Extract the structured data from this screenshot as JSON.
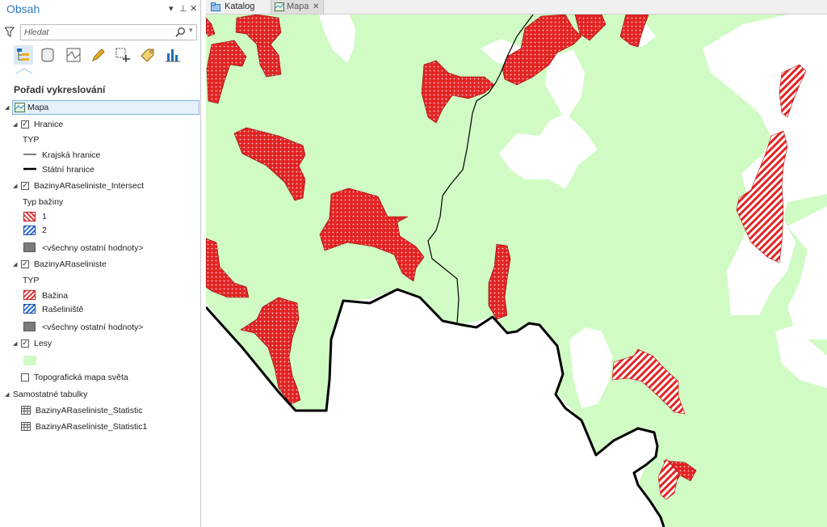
{
  "panel": {
    "title": "Obsah",
    "controls": {
      "menu": "▾",
      "pin": "⊥",
      "close": "✕"
    },
    "search": {
      "placeholder": "Hledat"
    },
    "section_title": "Pořadí vykreslování",
    "layers": {
      "map": "Mapa",
      "hranice": {
        "name": "Hranice",
        "checked": true,
        "heading": "TYP",
        "items": [
          "Krajská hranice",
          "Státní hranice"
        ]
      },
      "intersect": {
        "name": "BazinyARaseliniste_Intersect",
        "checked": true,
        "heading": "Typ bažiny",
        "items": [
          "1",
          "2",
          "<všechny ostatní hodnoty>"
        ]
      },
      "raseliniste": {
        "name": "BazinyARaseliniste",
        "checked": true,
        "heading": "TYP",
        "items": [
          "Bažina",
          "Rašeliniště",
          "<všechny ostatní hodnoty>"
        ]
      },
      "lesy": {
        "name": "Lesy",
        "checked": true
      },
      "basemap": {
        "name": "Topografická mapa světa",
        "checked": false
      }
    },
    "tables": {
      "heading": "Samostatné tabulky",
      "items": [
        "BazinyARaseliniste_Statistic",
        "BazinyARaseliniste_Statistic1"
      ]
    }
  },
  "tabs": [
    {
      "label": "Katalog",
      "icon": "catalog-icon"
    },
    {
      "label": "Mapa",
      "icon": "map-icon",
      "close": "✕"
    }
  ],
  "colors": {
    "forest": "#d1fbc4",
    "wetland_red": "#e32424",
    "border": "#000000",
    "accent": "#2b78c5"
  }
}
